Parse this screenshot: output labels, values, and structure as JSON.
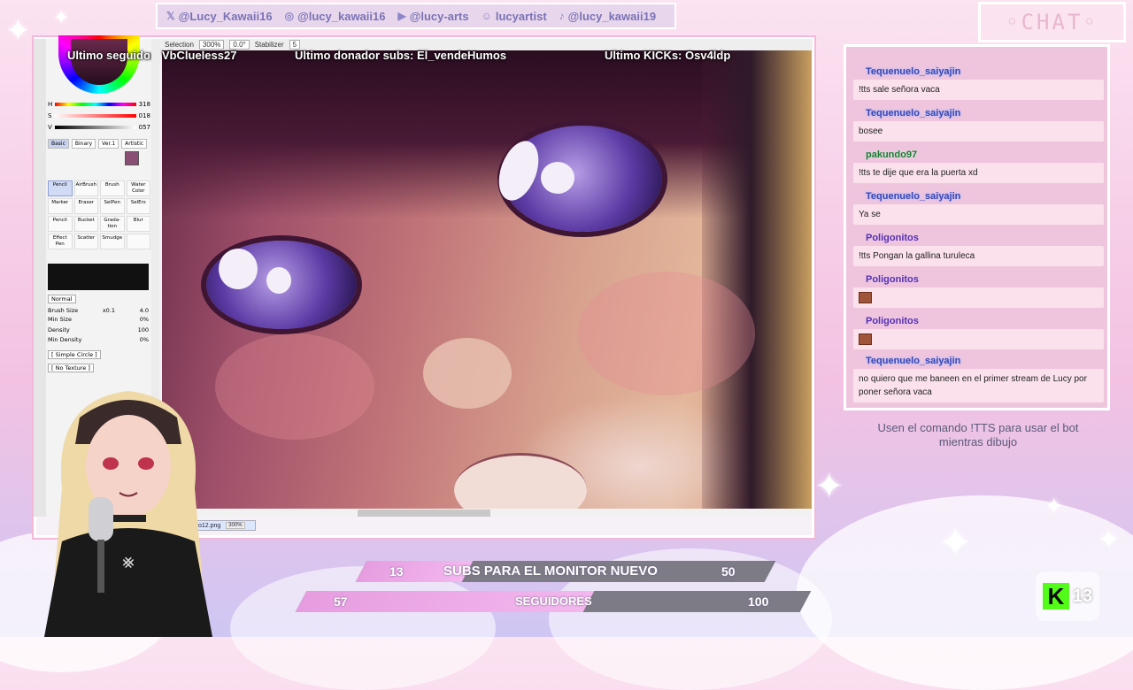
{
  "socials": [
    {
      "icon": "x-icon",
      "glyph": "𝕏",
      "handle": "@Lucy_Kawaii16"
    },
    {
      "icon": "instagram-icon",
      "glyph": "◎",
      "handle": "@lucy_kawaii16"
    },
    {
      "icon": "youtube-icon",
      "glyph": "▶",
      "handle": "@lucy-arts"
    },
    {
      "icon": "discord-icon",
      "glyph": "☺",
      "handle": "lucyartist"
    },
    {
      "icon": "tiktok-icon",
      "glyph": "♪",
      "handle": "@lucy_kawaii19"
    }
  ],
  "chat": {
    "header": "◦CHAT◦",
    "messages": [
      {
        "user": "Tequenuelo_saiyajin",
        "text": "!tts sale señora vaca"
      },
      {
        "user": "Tequenuelo_saiyajin",
        "text": "bosee"
      },
      {
        "user": "pakundo97",
        "text": "!tts te dije que era la puerta xd"
      },
      {
        "user": "Tequenuelo_saiyajin",
        "text": "Ya se"
      },
      {
        "user": "Poligonitos",
        "text": "!tts Pongan la gallina turuleca"
      },
      {
        "user": "Poligonitos",
        "text": ""
      },
      {
        "user": "Poligonitos",
        "text": ""
      },
      {
        "user": "Tequenuelo_saiyajin",
        "text": "no quiero que me baneen en el primer stream de Lucy por poner señora vaca"
      }
    ],
    "tts_note": "Usen el comando !TTS para usar el bot mientras dibujo"
  },
  "overlay": {
    "last_follower": "Ultimo seguidor: VbClueless27",
    "last_donor": "Ultimo donador subs: El_vendeHumos",
    "last_kicks": "Ultimo KICKs: Osv4ldp"
  },
  "app": {
    "toolbar": {
      "selection": "Selection",
      "zoom": "300%",
      "rotation": "0.0°",
      "stabilizer_label": "Stabilizer",
      "stabilizer_value": "5"
    },
    "color": {
      "h_label": "H",
      "h_value": "318",
      "s_label": "S",
      "s_value": "018",
      "v_label": "V",
      "v_value": "057"
    },
    "tool_tabs": [
      "Basic",
      "Binary",
      "Ver.1",
      "Artistic"
    ],
    "tools": [
      "Pencil",
      "AirBrush",
      "Brush",
      "Water Color",
      "Marker",
      "Eraser",
      "SelPen",
      "SelErs",
      "Pencil",
      "Bucket",
      "Grada-tion",
      "Blur",
      "Effect Pen",
      "Scatter",
      "Smudge",
      ""
    ],
    "blend_mode": "Normal",
    "brush_size_label": "Brush Size",
    "brush_size_multiplier": "x0.1",
    "brush_size_value": "4.0",
    "min_size_label": "Min Size",
    "min_size_value": "0%",
    "density_label": "Density",
    "density_value": "100",
    "min_density_label": "Min Density",
    "min_density_value": "0%",
    "shape": "[ Simple Circle ]",
    "texture": "[ No Texture ]",
    "file_name": "Dibujo12.png",
    "file_zoom": "300%"
  },
  "goals": [
    {
      "current": "13",
      "label": "SUBS PARA EL MONITOR NUEVO",
      "target": "50",
      "progress": 0.26
    },
    {
      "current": "57",
      "label": "SEGUIDORES",
      "target": "100",
      "progress": 0.57
    }
  ],
  "kick": {
    "letter": "K",
    "count": "13"
  }
}
